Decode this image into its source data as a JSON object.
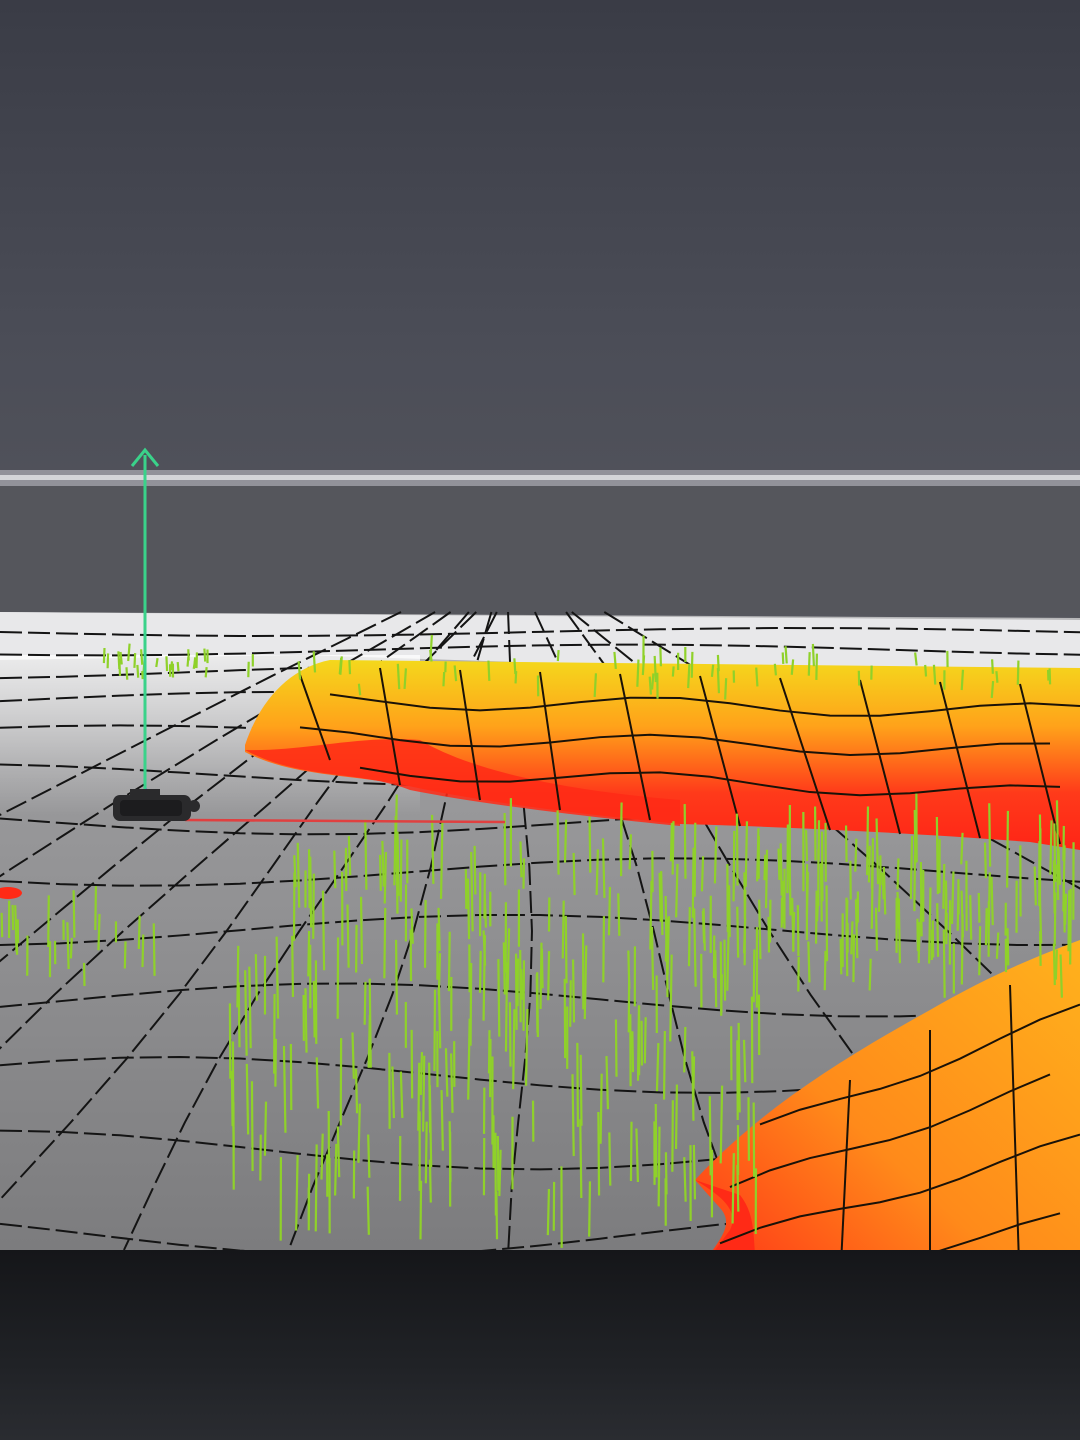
{
  "viewport": {
    "sky_color": "#4a4b55",
    "ground_color": "#8c8c8e",
    "wire_color": "#141414",
    "grass_color": "#8fd12a"
  },
  "gizmo": {
    "y_axis_color": "#3ad28a",
    "x_axis_color": "#e04040"
  },
  "terrain": {
    "hot_color": "#ff2a1a",
    "warm_color": "#ff9a1a",
    "cool_color": "#f4d21a"
  },
  "icons": [
    "up-arrow-icon",
    "camera-icon"
  ]
}
